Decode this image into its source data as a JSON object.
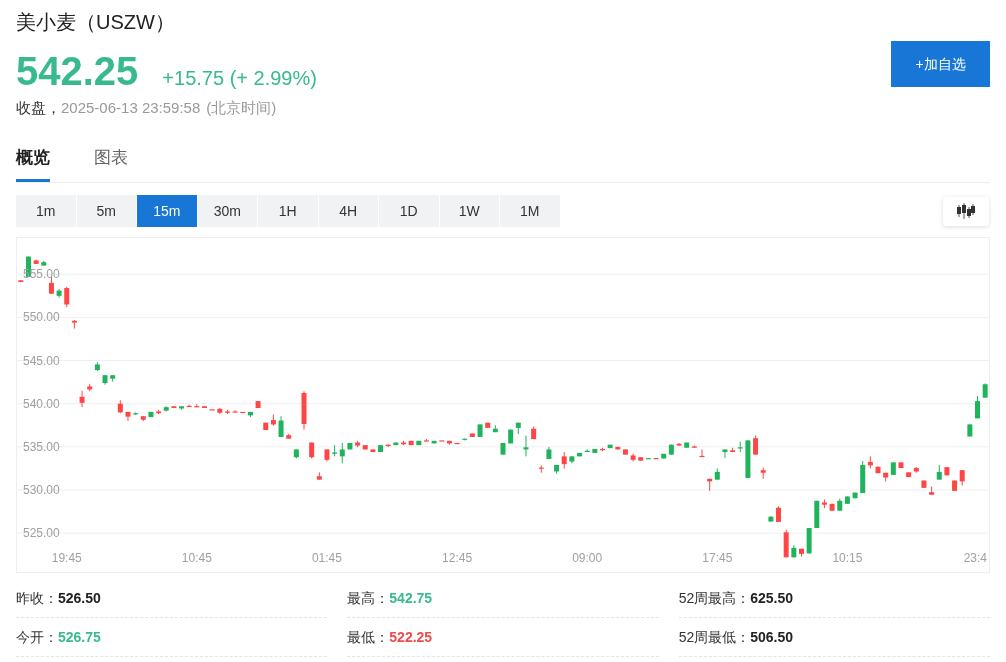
{
  "header": {
    "title": "美小麦（USZW）",
    "price": "542.25",
    "change": "+15.75 (+ 2.99%)",
    "status": "收盘，",
    "timestamp": "2025-06-13 23:59:58",
    "timezone": "(北京时间)",
    "watch_button": "+加自选"
  },
  "tabs": [
    {
      "label": "概览",
      "selected": true
    },
    {
      "label": "图表",
      "selected": false
    }
  ],
  "intervals": [
    {
      "label": "1m",
      "selected": false
    },
    {
      "label": "5m",
      "selected": false
    },
    {
      "label": "15m",
      "selected": true
    },
    {
      "label": "30m",
      "selected": false
    },
    {
      "label": "1H",
      "selected": false
    },
    {
      "label": "4H",
      "selected": false
    },
    {
      "label": "1D",
      "selected": false
    },
    {
      "label": "1W",
      "selected": false
    },
    {
      "label": "1M",
      "selected": false
    }
  ],
  "chart": {
    "chart_data": {
      "type": "candlestick",
      "grid": true,
      "ylim": [
        520.5,
        559.2
      ],
      "categories": [
        null,
        null,
        null,
        null,
        null,
        null,
        "19:45",
        null,
        null,
        null,
        null,
        null,
        null,
        null,
        null,
        null,
        null,
        null,
        null,
        null,
        null,
        null,
        null,
        "10:45",
        null,
        null,
        null,
        null,
        null,
        null,
        null,
        null,
        null,
        null,
        null,
        null,
        null,
        null,
        null,
        null,
        "01:45",
        null,
        null,
        null,
        null,
        null,
        null,
        null,
        null,
        null,
        null,
        null,
        null,
        null,
        null,
        null,
        null,
        "12:45",
        null,
        null,
        null,
        null,
        null,
        null,
        null,
        null,
        null,
        null,
        null,
        null,
        null,
        null,
        null,
        null,
        "09:00",
        null,
        null,
        null,
        null,
        null,
        null,
        null,
        null,
        null,
        null,
        null,
        null,
        null,
        null,
        null,
        null,
        "17:45",
        null,
        null,
        null,
        null,
        null,
        null,
        null,
        null,
        null,
        null,
        null,
        null,
        null,
        null,
        null,
        null,
        "10:15",
        null,
        null,
        null,
        null,
        null,
        null,
        null,
        null,
        null,
        null,
        null,
        null,
        null,
        null,
        null,
        null,
        "23:4",
        null
      ],
      "yticks": [
        {
          "value": 555,
          "label": "555.00"
        },
        {
          "value": 550,
          "label": "550.00"
        },
        {
          "value": 545,
          "label": "545.00"
        },
        {
          "value": 540,
          "label": "540.00"
        },
        {
          "value": 535,
          "label": "535.00"
        },
        {
          "value": 530,
          "label": "530.00"
        },
        {
          "value": 525,
          "label": "525.00"
        }
      ],
      "ohlc": [
        [
          554.3,
          554.3,
          554.1,
          554.1
        ],
        [
          554.7,
          557.05,
          554.7,
          557.05
        ],
        [
          556.6,
          556.7,
          556.2,
          556.2
        ],
        [
          556.0,
          556.55,
          556.0,
          556.4
        ],
        [
          554.0,
          554.7,
          552.7,
          552.75
        ],
        [
          552.5,
          553.3,
          552.3,
          553.1
        ],
        [
          553.4,
          553.55,
          551.2,
          551.5
        ],
        [
          549.6,
          549.7,
          548.7,
          549.4
        ],
        [
          540.8,
          541.5,
          539.6,
          540.1
        ],
        [
          542.0,
          542.3,
          541.45,
          541.65
        ],
        [
          543.9,
          544.8,
          543.8,
          544.55
        ],
        [
          542.4,
          543.3,
          542.2,
          543.3
        ],
        [
          542.9,
          543.3,
          542.55,
          543.3
        ],
        [
          540.0,
          540.4,
          538.9,
          539.0
        ],
        [
          539.05,
          539.05,
          538.0,
          538.5
        ],
        [
          538.8,
          539.0,
          538.7,
          538.9
        ],
        [
          538.55,
          538.55,
          538.0,
          538.15
        ],
        [
          538.45,
          539.05,
          538.45,
          539.05
        ],
        [
          539.1,
          539.3,
          538.8,
          538.9
        ],
        [
          539.2,
          539.7,
          539.1,
          539.6
        ],
        [
          539.7,
          539.7,
          539.5,
          539.5
        ],
        [
          539.45,
          539.7,
          539.3,
          539.7
        ],
        [
          539.75,
          539.9,
          539.65,
          539.65
        ],
        [
          539.72,
          539.95,
          539.68,
          539.68
        ],
        [
          539.7,
          539.7,
          539.5,
          539.5
        ],
        [
          539.35,
          539.35,
          539.3,
          539.3
        ],
        [
          539.4,
          539.5,
          538.8,
          538.95
        ],
        [
          539.1,
          539.3,
          538.8,
          538.95
        ],
        [
          539.1,
          539.25,
          539.05,
          539.05
        ],
        [
          539.05,
          539.05,
          539.0,
          539.0
        ],
        [
          538.65,
          539.05,
          538.45,
          539.05
        ],
        [
          540.3,
          540.3,
          539.5,
          539.5
        ],
        [
          537.8,
          537.8,
          536.95,
          536.95
        ],
        [
          538.1,
          538.75,
          537.45,
          537.6
        ],
        [
          536.15,
          538.55,
          536.15,
          538.05
        ],
        [
          536.35,
          536.5,
          535.95,
          535.95
        ],
        [
          533.8,
          534.7,
          533.65,
          534.7
        ],
        [
          541.25,
          541.45,
          537.0,
          537.65
        ],
        [
          535.5,
          535.5,
          533.65,
          533.8
        ],
        [
          531.6,
          532.05,
          531.2,
          531.2
        ],
        [
          534.7,
          534.7,
          533.3,
          533.5
        ],
        [
          534.2,
          535.2,
          533.9,
          534.35
        ],
        [
          533.9,
          535.45,
          533.1,
          534.7
        ],
        [
          534.7,
          535.45,
          534.7,
          535.45
        ],
        [
          535.5,
          535.7,
          534.95,
          535.15
        ],
        [
          535.2,
          535.2,
          534.7,
          534.7
        ],
        [
          534.7,
          534.7,
          534.4,
          534.4
        ],
        [
          534.4,
          535.2,
          534.4,
          535.2
        ],
        [
          535.25,
          535.25,
          534.95,
          535.1
        ],
        [
          535.2,
          535.5,
          535.2,
          535.5
        ],
        [
          535.5,
          535.7,
          535.2,
          535.3
        ],
        [
          535.7,
          535.7,
          535.2,
          535.2
        ],
        [
          535.2,
          535.7,
          535.2,
          535.7
        ],
        [
          535.75,
          535.9,
          535.7,
          535.7
        ],
        [
          535.4,
          535.7,
          535.4,
          535.7
        ],
        [
          535.75,
          535.75,
          535.7,
          535.7
        ],
        [
          535.7,
          535.7,
          535.25,
          535.4
        ],
        [
          535.45,
          535.45,
          535.4,
          535.4
        ],
        [
          535.85,
          535.95,
          535.75,
          535.95
        ],
        [
          536.55,
          536.55,
          536.15,
          536.15
        ],
        [
          536.15,
          537.6,
          536.15,
          537.6
        ],
        [
          537.8,
          537.8,
          537.2,
          537.2
        ],
        [
          536.7,
          537.5,
          536.7,
          537.1
        ],
        [
          534.1,
          535.45,
          534.1,
          535.45
        ],
        [
          535.4,
          537.0,
          535.4,
          537.0
        ],
        [
          537.2,
          537.8,
          536.5,
          537.8
        ],
        [
          534.7,
          536.3,
          533.9,
          534.95
        ],
        [
          537.1,
          537.35,
          535.9,
          535.9
        ],
        [
          532.6,
          532.85,
          532.0,
          532.5
        ],
        [
          533.6,
          535.0,
          533.6,
          534.7
        ],
        [
          532.15,
          532.9,
          531.9,
          532.9
        ],
        [
          533.9,
          534.4,
          532.5,
          533.0
        ],
        [
          533.3,
          533.9,
          533.1,
          533.9
        ],
        [
          533.9,
          534.3,
          533.9,
          534.3
        ],
        [
          534.4,
          534.7,
          534.4,
          534.55
        ],
        [
          534.3,
          534.75,
          534.3,
          534.75
        ],
        [
          534.75,
          534.9,
          534.5,
          534.7
        ],
        [
          534.85,
          535.25,
          534.85,
          535.25
        ],
        [
          535.0,
          535.0,
          534.7,
          534.7
        ],
        [
          534.7,
          534.7,
          534.1,
          534.1
        ],
        [
          534.0,
          534.2,
          533.3,
          533.5
        ],
        [
          533.8,
          533.8,
          533.4,
          533.4
        ],
        [
          533.65,
          533.7,
          533.65,
          533.7
        ],
        [
          533.7,
          533.7,
          533.65,
          533.65
        ],
        [
          533.65,
          534.2,
          533.65,
          534.2
        ],
        [
          534.1,
          535.25,
          534.1,
          535.25
        ],
        [
          535.35,
          535.45,
          535.15,
          535.15
        ],
        [
          534.9,
          535.5,
          534.9,
          535.5
        ],
        [
          535.05,
          535.15,
          534.9,
          534.9
        ],
        [
          533.95,
          534.7,
          533.9,
          533.9
        ],
        [
          531.3,
          531.3,
          529.9,
          531.0
        ],
        [
          531.2,
          532.5,
          531.2,
          532.1
        ],
        [
          534.4,
          534.7,
          533.7,
          534.7
        ],
        [
          534.6,
          534.9,
          534.4,
          534.4
        ],
        [
          534.85,
          535.6,
          534.4,
          534.95
        ],
        [
          531.4,
          535.75,
          531.4,
          535.75
        ],
        [
          536.0,
          536.3,
          534.1,
          534.1
        ],
        [
          532.3,
          532.6,
          531.3,
          532.0
        ],
        [
          526.35,
          527.0,
          526.3,
          526.9
        ],
        [
          527.95,
          528.1,
          526.3,
          526.3
        ],
        [
          525.1,
          525.4,
          522.2,
          522.2
        ],
        [
          522.2,
          523.6,
          522.2,
          523.3
        ],
        [
          523.2,
          523.2,
          522.3,
          522.6
        ],
        [
          522.65,
          525.6,
          522.65,
          525.6
        ],
        [
          525.6,
          528.75,
          525.6,
          528.75
        ],
        [
          528.55,
          528.9,
          527.9,
          528.3
        ],
        [
          528.4,
          528.4,
          527.6,
          527.6
        ],
        [
          527.6,
          529.0,
          527.6,
          528.75
        ],
        [
          528.4,
          529.25,
          528.4,
          529.25
        ],
        [
          529.05,
          529.7,
          529.05,
          529.7
        ],
        [
          529.65,
          533.35,
          529.65,
          532.9
        ],
        [
          533.25,
          533.9,
          532.5,
          532.85
        ],
        [
          532.7,
          532.7,
          531.95,
          531.95
        ],
        [
          532.0,
          532.0,
          531.0,
          531.45
        ],
        [
          531.75,
          533.2,
          531.75,
          533.2
        ],
        [
          533.2,
          533.2,
          532.55,
          532.55
        ],
        [
          532.05,
          532.05,
          531.5,
          531.5
        ],
        [
          532.55,
          532.65,
          532.0,
          532.15
        ],
        [
          531.1,
          531.1,
          530.25,
          530.25
        ],
        [
          529.75,
          530.4,
          529.45,
          529.45
        ],
        [
          531.2,
          532.9,
          531.2,
          532.1
        ],
        [
          532.65,
          532.65,
          531.7,
          531.7
        ],
        [
          531.1,
          531.1,
          529.9,
          529.9
        ],
        [
          532.3,
          532.3,
          530.5,
          531.0
        ],
        [
          536.2,
          537.6,
          536.2,
          537.6
        ],
        [
          538.3,
          540.9,
          538.3,
          540.3
        ],
        [
          540.7,
          542.35,
          540.7,
          542.25
        ]
      ]
    }
  },
  "stats": [
    {
      "label": "昨收：",
      "value": "526.50",
      "color": "#222222"
    },
    {
      "label": "最高：",
      "value": "542.75",
      "color": "#38b98f"
    },
    {
      "label": "52周最高：",
      "value": "625.50",
      "color": "#222222"
    },
    {
      "label": "今开：",
      "value": "526.75",
      "color": "#38b98f"
    },
    {
      "label": "最低：",
      "value": "522.25",
      "color": "#f04a4a"
    },
    {
      "label": "52周最低：",
      "value": "506.50",
      "color": "#222222"
    }
  ]
}
